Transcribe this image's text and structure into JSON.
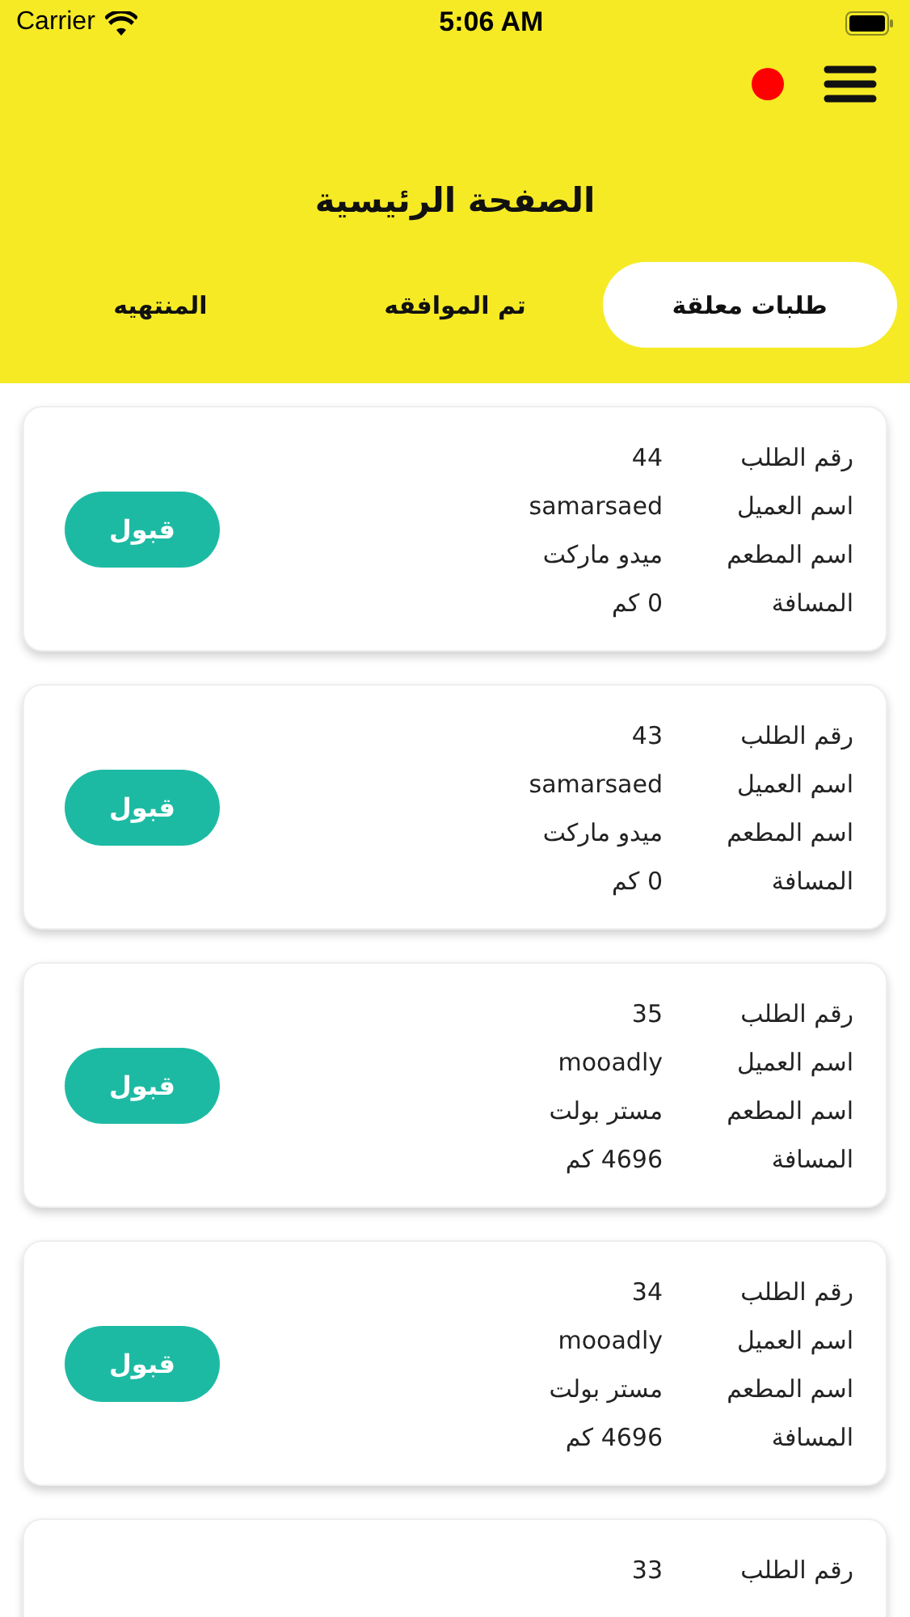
{
  "status_bar": {
    "carrier": "Carrier",
    "time": "5:06 AM"
  },
  "header": {
    "notification_dot": {
      "color": "#ff0000"
    },
    "title": "الصفحة الرئيسية"
  },
  "tabs": [
    {
      "label": "طلبات معلقة",
      "selected": true
    },
    {
      "label": "تم الموافقه",
      "selected": false
    },
    {
      "label": "المنتهيه",
      "selected": false
    }
  ],
  "orders": [
    {
      "fields": [
        {
          "label": "رقم الطلب",
          "value": "44"
        },
        {
          "label": "اسم العميل",
          "value": "samarsaed"
        },
        {
          "label": "اسم المطعم",
          "value": "ميدو ماركت"
        },
        {
          "label": "المسافة",
          "value": "0 كم"
        }
      ],
      "button": "قبول"
    },
    {
      "fields": [
        {
          "label": "رقم الطلب",
          "value": "43"
        },
        {
          "label": "اسم العميل",
          "value": "samarsaed"
        },
        {
          "label": "اسم المطعم",
          "value": "ميدو ماركت"
        },
        {
          "label": "المسافة",
          "value": "0 كم"
        }
      ],
      "button": "قبول"
    },
    {
      "fields": [
        {
          "label": "رقم الطلب",
          "value": "35"
        },
        {
          "label": "اسم العميل",
          "value": "mooadly"
        },
        {
          "label": "اسم المطعم",
          "value": "مستر بولت"
        },
        {
          "label": "المسافة",
          "value": "4696 كم"
        }
      ],
      "button": "قبول"
    },
    {
      "fields": [
        {
          "label": "رقم الطلب",
          "value": "34"
        },
        {
          "label": "اسم العميل",
          "value": "mooadly"
        },
        {
          "label": "اسم المطعم",
          "value": "مستر بولت"
        },
        {
          "label": "المسافة",
          "value": "4696 كم"
        }
      ],
      "button": "قبول"
    },
    {
      "fields": [
        {
          "label": "رقم الطلب",
          "value": "33"
        }
      ]
    }
  ]
}
